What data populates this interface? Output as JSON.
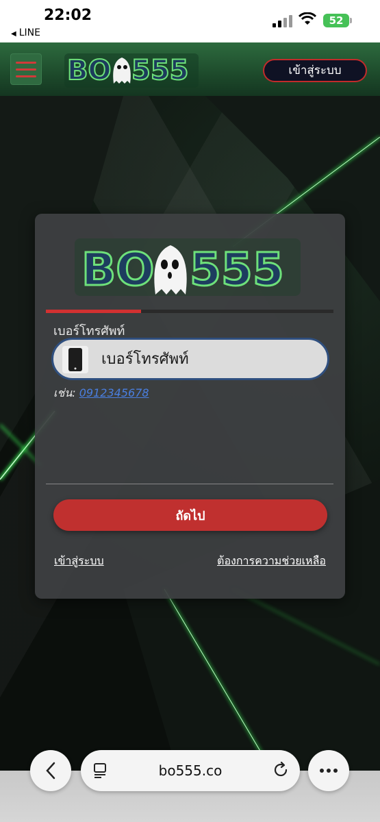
{
  "status_bar": {
    "time": "22:02",
    "back_app": "LINE",
    "battery": "52"
  },
  "header": {
    "logo_text_left": "BO",
    "logo_text_right": "555",
    "login_button": "เข้าสู่ระบบ",
    "menu_icon": "hamburger-icon"
  },
  "card": {
    "logo_text_left": "BO",
    "logo_text_right": "555",
    "progress": 0.33,
    "field_label": "เบอร์โทรศัพท์",
    "phone_placeholder": "เบอร์โทรศัพท์",
    "example_prefix": "เช่น:",
    "example_number": "0912345678",
    "next_button": "ถัดไป",
    "login_link": "เข้าสู่ระบบ",
    "help_link": "ต้องการความช่วยเหลือ"
  },
  "browser": {
    "url": "bo555.co"
  },
  "colors": {
    "accent_red": "#c0302f",
    "header_green": "#2d6a3e",
    "input_border": "#2f4f7f"
  }
}
